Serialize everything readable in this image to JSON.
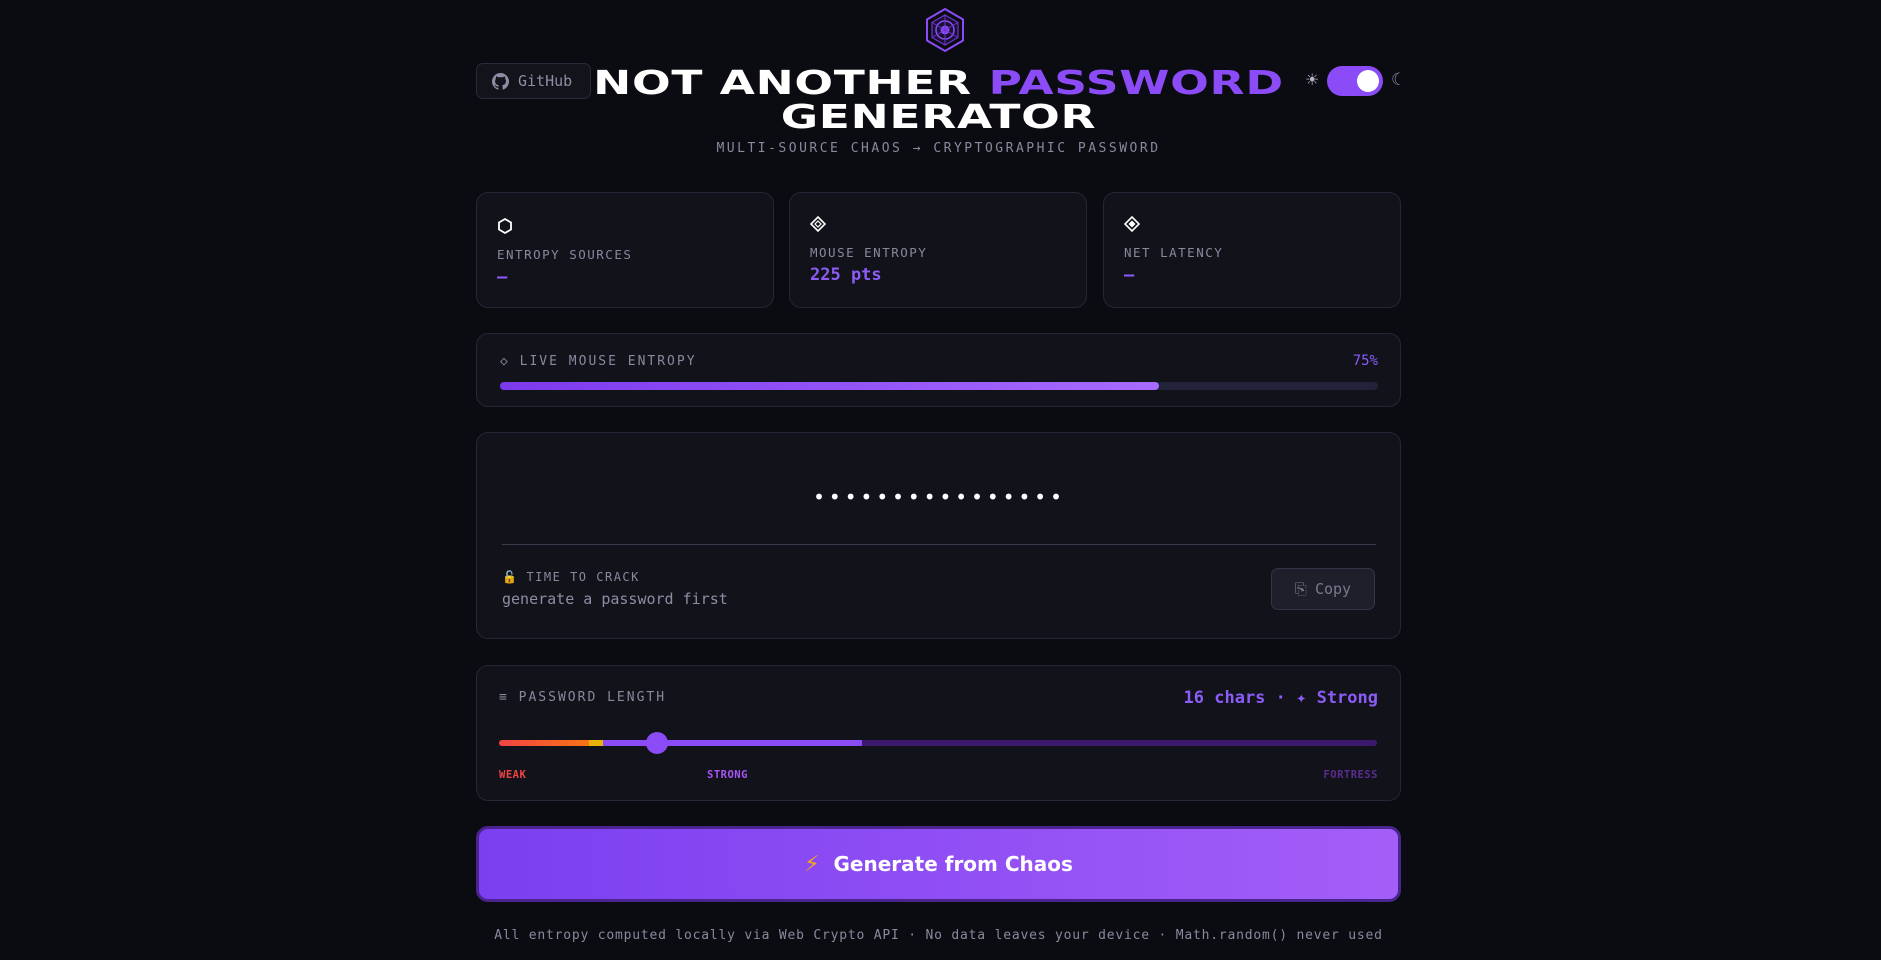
{
  "header": {
    "github_label": "GitHub",
    "title_line1_a": "NOT ANOTHER",
    "title_line1_b": "PASSWORD",
    "title_line2": "GENERATOR",
    "subtitle": "MULTI-SOURCE CHAOS → CRYPTOGRAPHIC PASSWORD",
    "theme": {
      "sun_glyph": "☀",
      "moon_glyph": "☾",
      "dark_mode": true
    }
  },
  "stats": [
    {
      "icon": "hexagon-icon",
      "label": "ENTROPY SOURCES",
      "value": "—"
    },
    {
      "icon": "diamond-icon",
      "label": "MOUSE ENTROPY",
      "value": "225 pts"
    },
    {
      "icon": "diamond-grid-icon",
      "label": "NET LATENCY",
      "value": "—"
    }
  ],
  "live_entropy": {
    "icon_glyph": "◇",
    "label": "LIVE MOUSE ENTROPY",
    "percent_label": "75%",
    "progress": 0.75
  },
  "password": {
    "masked": "••••••••••••••••",
    "lock_glyph": "🔓",
    "time_to_crack_label": "TIME TO CRACK",
    "time_to_crack_hint": "generate a password first",
    "copy_glyph": "⎘",
    "copy_label": "Copy"
  },
  "length": {
    "icon_glyph": "≡",
    "label": "PASSWORD LENGTH",
    "summary": "16 chars · ✦ Strong",
    "value_fraction": 0.18,
    "ticks": [
      {
        "label": "WEAK",
        "color": "#ef4444"
      },
      {
        "label": "STRONG",
        "color": "#a855f7"
      },
      {
        "label": "FORTRESS",
        "color": "#5b2d8f"
      }
    ]
  },
  "generate": {
    "bolt_glyph": "⚡",
    "label": "Generate from Chaos"
  },
  "footer": "All entropy computed locally via Web Crypto API · No data leaves your device · Math.random() never used",
  "colors": {
    "accent": "#8b4cf7",
    "background": "#0b0b12",
    "card": "#12121b"
  }
}
